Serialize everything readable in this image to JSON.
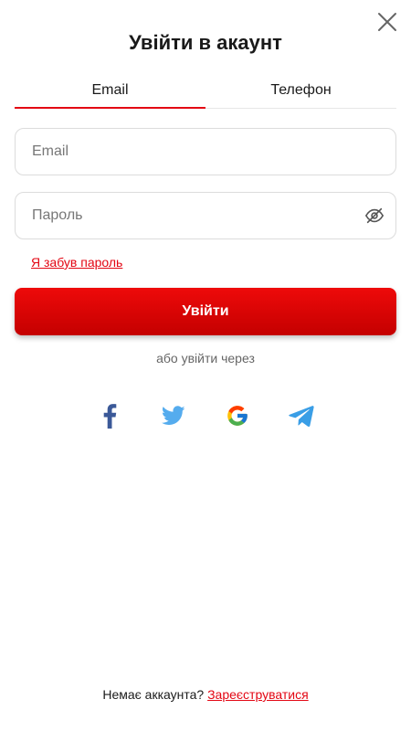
{
  "header": {
    "title": "Увійти в акаунт",
    "close_icon": "close-icon"
  },
  "tabs": [
    {
      "label": "Email",
      "active": true
    },
    {
      "label": "Телефон",
      "active": false
    }
  ],
  "form": {
    "email": {
      "placeholder": "Email",
      "value": ""
    },
    "password": {
      "placeholder": "Пароль",
      "value": "",
      "toggle_icon": "eye-off-icon"
    },
    "forgot_link": "Я забув пароль",
    "submit_label": "Увійти"
  },
  "social": {
    "divider_text": "або увійти через",
    "providers": [
      "facebook-icon",
      "twitter-icon",
      "google-icon",
      "telegram-icon"
    ]
  },
  "footer": {
    "prompt": "Немає аккаунта?",
    "register_link": "Зареєструватися"
  },
  "colors": {
    "accent": "#e30613",
    "button_top": "#ee0a0a",
    "button_bottom": "#c40000"
  }
}
